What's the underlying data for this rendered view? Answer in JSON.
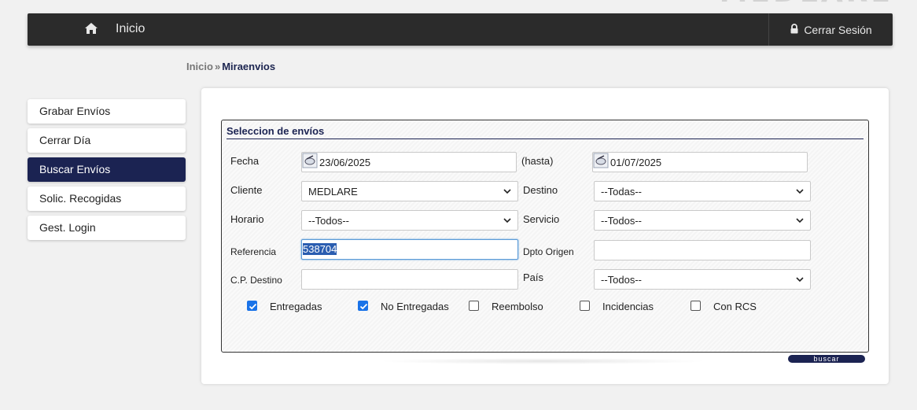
{
  "brand": {
    "logo_text": "MEDLARE"
  },
  "topbar": {
    "home_label": "Inicio",
    "logout_label": "Cerrar Sesión"
  },
  "breadcrumb": {
    "home": "Inicio",
    "separator": "»",
    "current": "Miraenvios"
  },
  "sidebar": {
    "items": [
      {
        "label": "Grabar Envíos",
        "active": false
      },
      {
        "label": "Cerrar Día",
        "active": false
      },
      {
        "label": "Buscar Envíos",
        "active": true
      },
      {
        "label": "Solic. Recogidas",
        "active": false
      },
      {
        "label": "Gest. Login",
        "active": false
      }
    ]
  },
  "form": {
    "title": "Seleccion de envíos",
    "fecha_label": "Fecha",
    "fecha_desde": "23/06/2025",
    "hasta_label": "(hasta)",
    "fecha_hasta": "01/07/2025",
    "cliente_label": "Cliente",
    "cliente_value": "MEDLARE",
    "destino_label": "Destino",
    "destino_value": "--Todas--",
    "horario_label": "Horario",
    "horario_value": "--Todos--",
    "servicio_label": "Servicio",
    "servicio_value": "--Todos--",
    "referencia_label": "Referencia",
    "referencia_value": "538704",
    "dpto_origen_label": "Dpto Origen",
    "dpto_origen_value": "",
    "cp_destino_label": "C.P. Destino",
    "cp_destino_value": "",
    "pais_label": "País",
    "pais_value": "--Todos--",
    "checkboxes": [
      {
        "label": "Entregadas",
        "checked": true
      },
      {
        "label": "No Entregadas",
        "checked": true
      },
      {
        "label": "Reembolso",
        "checked": false
      },
      {
        "label": "Incidencias",
        "checked": false
      },
      {
        "label": "Con RCS",
        "checked": false
      }
    ],
    "search_button": "buscar"
  },
  "colors": {
    "topbar": "#2b2b2b",
    "accent_navy": "#1b2352",
    "checkbox_on": "#1a73e8",
    "page_bg": "#f1f1f1"
  },
  "icons": [
    "home-icon",
    "lock-icon",
    "calendar-icon",
    "chevron-down-icon",
    "checkmark-icon"
  ]
}
